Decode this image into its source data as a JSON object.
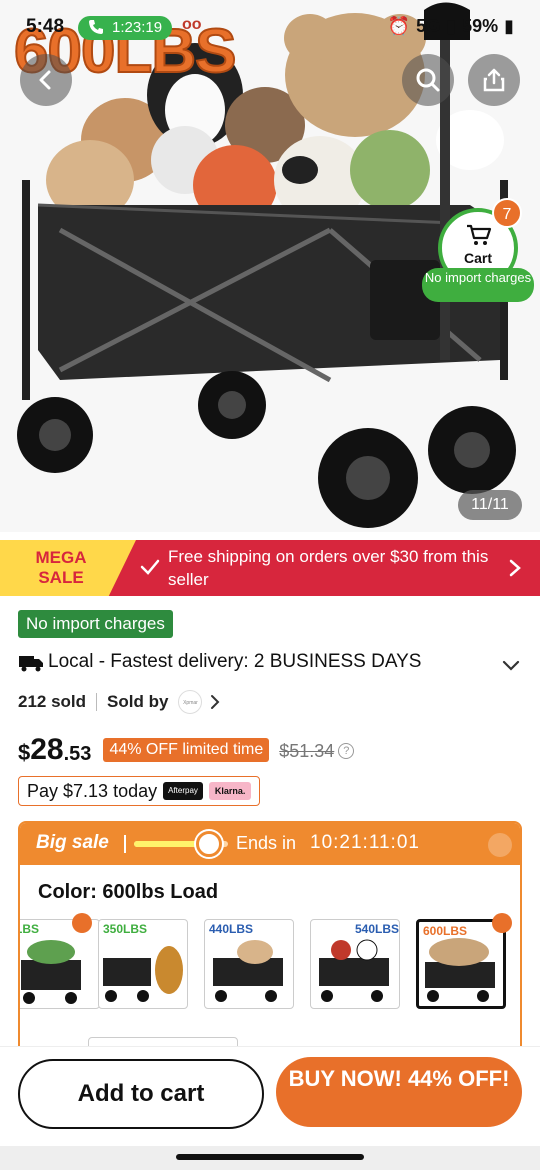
{
  "status_bar": {
    "time": "5:48",
    "call_duration": "1:23:19",
    "network": "5G",
    "battery": "59%"
  },
  "hero": {
    "brand_text": "600LBS",
    "image_counter": "11/11",
    "cart_label": "Cart",
    "cart_count": "7",
    "cart_no_import": "No import charges"
  },
  "mega_sale": {
    "badge": "MEGA SALE",
    "message": "Free shipping on orders over $30 from this seller"
  },
  "product": {
    "no_import_label": "No import charges",
    "delivery_text": "Local - Fastest delivery: 2 BUSINESS DAYS",
    "sold_count": "212 sold",
    "sold_by_label": "Sold by",
    "seller_logo_text": "Xpmar",
    "price_currency": "$",
    "price_whole": "28",
    "price_cents": ".53",
    "discount_badge": "44% OFF limited time",
    "original_price": "$51.34",
    "pay_today": "Pay $7.13 today",
    "afterpay_label": "Afterpay",
    "klarna_label": "Klarna."
  },
  "sale_card": {
    "title": "Big sale",
    "ends_label": "Ends in",
    "countdown": "10:21:11:01",
    "progress": 0.7,
    "color_label": "Color: 600lbs Load",
    "options": [
      {
        "label": "LBS"
      },
      {
        "label": "350LBS"
      },
      {
        "label": "440LBS"
      },
      {
        "label": "540LBS"
      },
      {
        "label": "600LBS"
      }
    ]
  },
  "actions": {
    "add_to_cart": "Add to cart",
    "buy_now": "BUY NOW! 44% OFF!"
  },
  "colors": {
    "accent_orange": "#e8702a",
    "sale_red": "#d7263d",
    "green": "#2e8b3e"
  }
}
